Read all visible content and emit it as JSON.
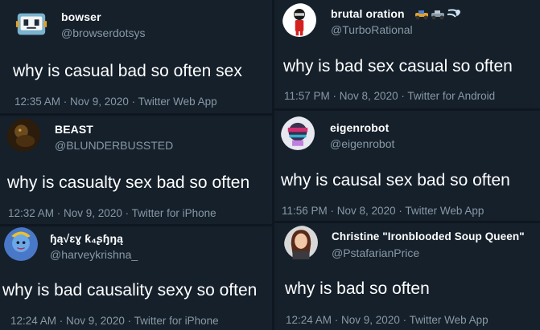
{
  "tweets": [
    {
      "name": "bowser",
      "handle": "@browserdotsys",
      "text": "why is casual bad so often sex",
      "meta": "12:35 AM · Nov 9, 2020 · Twitter Web App"
    },
    {
      "name": "brutal oration",
      "handle": "@TurboRational",
      "text": "why is bad sex casual so often",
      "meta": "11:57 PM · Nov 8, 2020 · Twitter for Android",
      "name_emojis": [
        "racing-car-icon",
        "racing-car-icon",
        "dash-icon"
      ]
    },
    {
      "name": "BEAST",
      "handle": "@BLUNDERBUSSTED",
      "text": "why is casualty sex bad so often",
      "meta": "12:32 AM · Nov 9, 2020 · Twitter for iPhone"
    },
    {
      "name": "eigenrobot",
      "handle": "@eigenrobot",
      "text": "why is causal sex bad so often",
      "meta": "11:56 PM · Nov 8, 2020 · Twitter Web App"
    },
    {
      "name": "ɧą√ɛɣ ƙ₄ʂɧŋą",
      "handle": "@harveykrishna_",
      "text": "why is bad causality sexy so often",
      "meta": "12:24 AM · Nov 9, 2020 · Twitter for iPhone"
    },
    {
      "name": "Christine \"Ironblooded Soup Queen\"",
      "handle": "@PstafarianPrice",
      "text": "why is bad so often",
      "meta": "12:24 AM · Nov 9, 2020 · Twitter Web App"
    }
  ],
  "colors": {
    "background": "#15202b",
    "secondary_text": "#8899a6",
    "primary_text": "#ffffff"
  }
}
